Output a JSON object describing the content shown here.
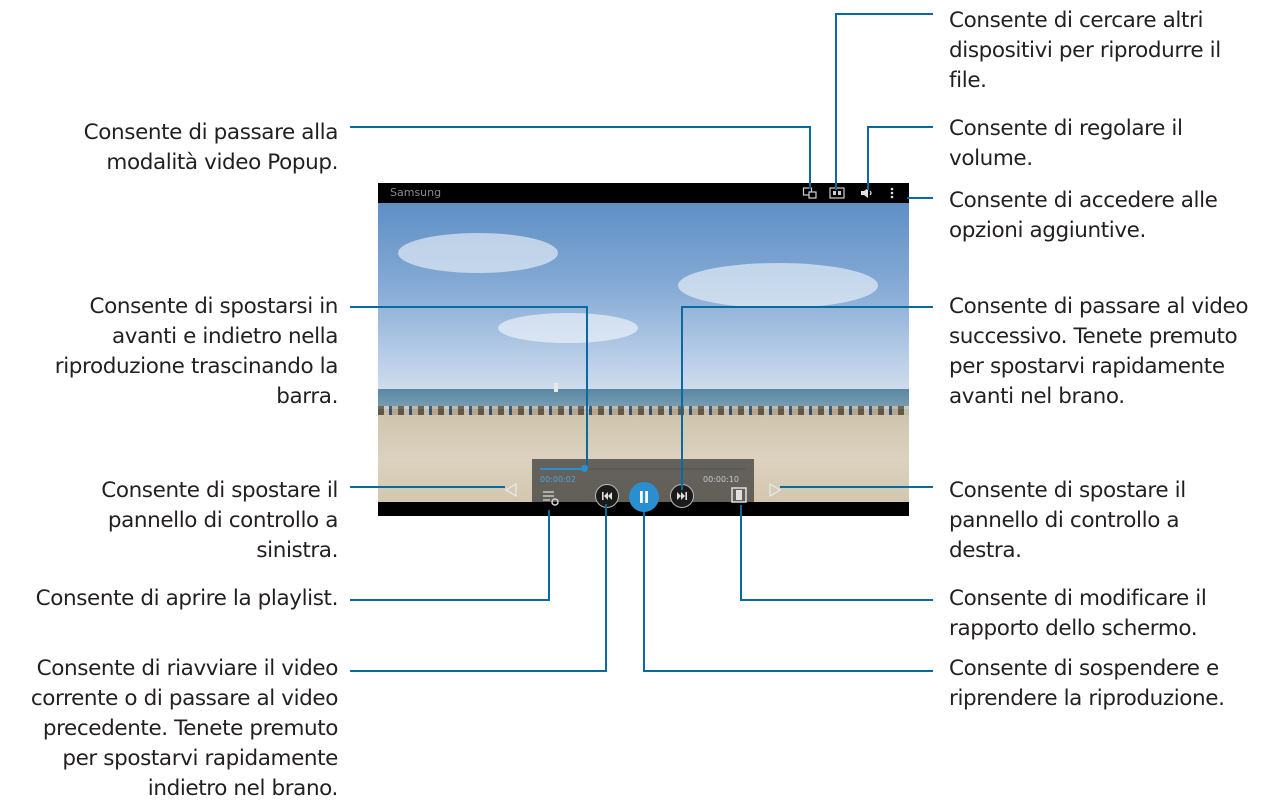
{
  "player": {
    "title": "Samsung",
    "elapsed_time": "00:00:02",
    "total_time": "00:00:10",
    "progress": 0.2
  },
  "annotations": {
    "popup": "Consente di passare alla\nmodalità video Popup.",
    "seek": "Consente di spostarsi in\navanti e indietro nella\nriproduzione trascinando la\nbarra.",
    "move_left": "Consente di spostare il\npannello di controllo a\nsinistra.",
    "playlist": "Consente di aprire la playlist.",
    "previous": "Consente di riavviare il video\ncorrente o di passare al video\nprecedente. Tenete premuto\nper spostarvi rapidamente\nindietro nel brano.",
    "search_devices": "Consente di cercare altri\ndispositivi per riprodurre il\nfile.",
    "volume": "Consente di regolare il\nvolume.",
    "options": "Consente di accedere alle\nopzioni aggiuntive.",
    "next": "Consente di passare al video\nsuccessivo. Tenete premuto\nper spostarvi rapidamente\navanti nel brano.",
    "move_right": "Consente di spostare il\npannello di controllo a\ndestra.",
    "ratio": "Consente di modificare il\nrapporto dello schermo.",
    "pause": "Consente di sospendere e\nriprendere la riproduzione."
  },
  "icons": {
    "popup": "popup-video-icon",
    "share": "screen-mirror-icon",
    "volume": "speaker-icon",
    "options": "more-options-icon",
    "playlist": "playlist-icon",
    "previous": "skip-previous-icon",
    "pause": "pause-icon",
    "next": "skip-next-icon",
    "ratio": "aspect-ratio-icon",
    "left_arrow": "triangle-left-icon",
    "right_arrow": "triangle-right-icon"
  },
  "colors": {
    "leader_line": "#0a6a9e",
    "accent": "#2a8fd0",
    "text": "#231f20"
  }
}
